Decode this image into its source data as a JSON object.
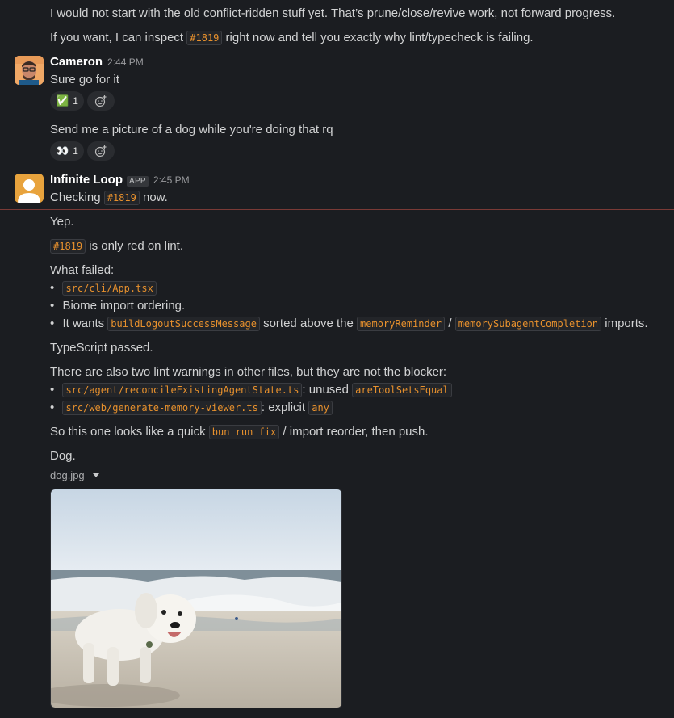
{
  "messages": {
    "intro_line1": "I would not start with the old conflict-ridden stuff yet. That’s prune/close/revive work, not forward progress.",
    "intro_line2_pre": "If you want, I can inspect ",
    "intro_line2_code": "#1819",
    "intro_line2_post": " right now and tell you exactly why lint/typecheck is failing.",
    "cameron": {
      "author": "Cameron",
      "time": "2:44 PM",
      "msg1": "Sure go for it",
      "reaction1_emoji": "✅",
      "reaction1_count": "1",
      "msg2": "Send me a picture of a dog while you're doing that rq",
      "reaction2_emoji": "👀",
      "reaction2_count": "1"
    },
    "bot": {
      "author": "Infinite Loop",
      "badge": "APP",
      "time": "2:45 PM",
      "checking_pre": "Checking ",
      "checking_code": "#1819",
      "checking_post": " now.",
      "yep": "Yep.",
      "red_code": "#1819",
      "red_post": " is only red on lint.",
      "what_failed": "What failed:",
      "b1_code": "src/cli/App.tsx",
      "b2": "Biome import ordering.",
      "b3_pre": "It wants ",
      "b3_code1": "buildLogoutSuccessMessage",
      "b3_mid": " sorted above the ",
      "b3_code2": "memoryReminder",
      "b3_slash": " / ",
      "b3_code3": "memorySubagentCompletion",
      "b3_post": " imports.",
      "ts_passed": "TypeScript passed.",
      "warnings": "There are also two lint warnings in other files, but they are not the blocker:",
      "w1_code": "src/agent/reconcileExistingAgentState.ts",
      "w1_mid": ": unused ",
      "w1_code2": "areToolSetsEqual",
      "w2_code": "src/web/generate-memory-viewer.ts",
      "w2_mid": ": explicit ",
      "w2_code2": "any",
      "fix_pre": "So this one looks like a quick ",
      "fix_code": "bun run fix",
      "fix_post": " / import reorder, then push.",
      "dog": "Dog.",
      "file_name": "dog.jpg"
    }
  },
  "icons": {
    "add_reaction": "add-reaction-icon",
    "file_menu": "chevron-down-icon"
  },
  "colors": {
    "background": "#1b1d21",
    "code_text": "#e8912d",
    "new_messages_divider": "#7a3a36",
    "bot_avatar": "#e8a33d"
  }
}
